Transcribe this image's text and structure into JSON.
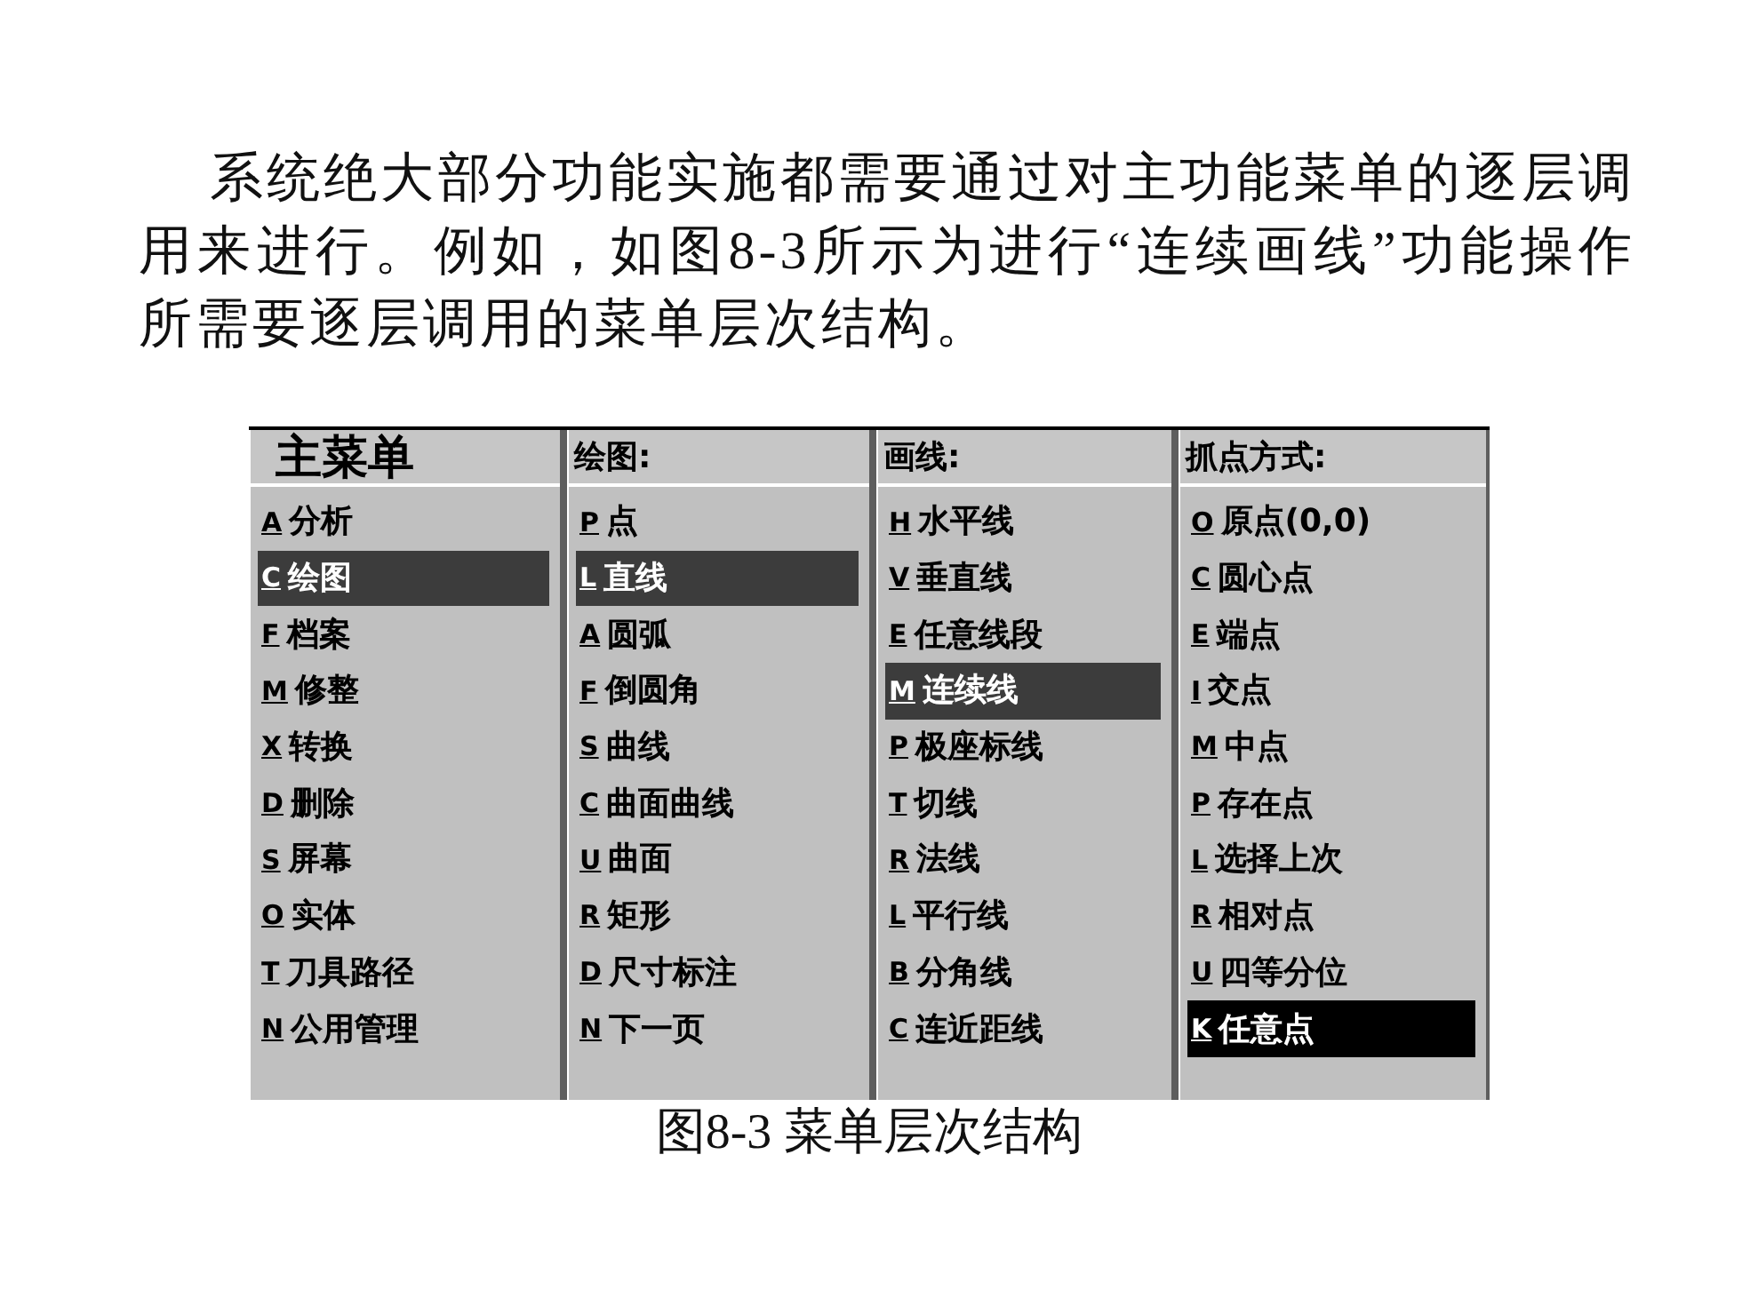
{
  "paragraph": "系统绝大部分功能实施都需要通过对主功能菜单的逐层调用来进行。例如，如图8-3所示为进行“连续画线”功能操作所需要逐层调用的菜单层次结构。",
  "figure": {
    "menus": [
      {
        "kind": "main",
        "title": "主菜单",
        "focused": false,
        "items": [
          {
            "key": "A",
            "label": "分析",
            "selected": false
          },
          {
            "key": "C",
            "label": "绘图",
            "selected": true
          },
          {
            "key": "F",
            "label": "档案",
            "selected": false
          },
          {
            "key": "M",
            "label": "修整",
            "selected": false
          },
          {
            "key": "X",
            "label": "转换",
            "selected": false
          },
          {
            "key": "D",
            "label": "删除",
            "selected": false
          },
          {
            "key": "S",
            "label": "屏幕",
            "selected": false
          },
          {
            "key": "O",
            "label": "实体",
            "selected": false
          },
          {
            "key": "T",
            "label": "刀具路径",
            "selected": false
          },
          {
            "key": "N",
            "label": "公用管理",
            "selected": false
          }
        ]
      },
      {
        "kind": "sub",
        "title": "绘图:",
        "focused": false,
        "items": [
          {
            "key": "P",
            "label": "点",
            "selected": false
          },
          {
            "key": "L",
            "label": "直线",
            "selected": true
          },
          {
            "key": "A",
            "label": "圆弧",
            "selected": false
          },
          {
            "key": "F",
            "label": "倒圆角",
            "selected": false
          },
          {
            "key": "S",
            "label": "曲线",
            "selected": false
          },
          {
            "key": "C",
            "label": "曲面曲线",
            "selected": false
          },
          {
            "key": "U",
            "label": "曲面",
            "selected": false
          },
          {
            "key": "R",
            "label": "矩形",
            "selected": false
          },
          {
            "key": "D",
            "label": "尺寸标注",
            "selected": false
          },
          {
            "key": "N",
            "label": "下一页",
            "selected": false
          }
        ]
      },
      {
        "kind": "sub",
        "title": "画线:",
        "focused": false,
        "items": [
          {
            "key": "H",
            "label": "水平线",
            "selected": false
          },
          {
            "key": "V",
            "label": "垂直线",
            "selected": false
          },
          {
            "key": "E",
            "label": "任意线段",
            "selected": false
          },
          {
            "key": "M",
            "label": "连续线",
            "selected": true
          },
          {
            "key": "P",
            "label": "极座标线",
            "selected": false
          },
          {
            "key": "T",
            "label": "切线",
            "selected": false
          },
          {
            "key": "R",
            "label": "法线",
            "selected": false
          },
          {
            "key": "L",
            "label": "平行线",
            "selected": false
          },
          {
            "key": "B",
            "label": "分角线",
            "selected": false
          },
          {
            "key": "C",
            "label": "连近距线",
            "selected": false
          }
        ]
      },
      {
        "kind": "sub",
        "title": "抓点方式:",
        "focused": true,
        "items": [
          {
            "key": "O",
            "label": "原点(0,0)",
            "selected": false
          },
          {
            "key": "C",
            "label": "圆心点",
            "selected": false
          },
          {
            "key": "E",
            "label": "端点",
            "selected": false
          },
          {
            "key": "I",
            "label": "交点",
            "selected": false
          },
          {
            "key": "M",
            "label": "中点",
            "selected": false
          },
          {
            "key": "P",
            "label": "存在点",
            "selected": false
          },
          {
            "key": "L",
            "label": "选择上次",
            "selected": false
          },
          {
            "key": "R",
            "label": "相对点",
            "selected": false
          },
          {
            "key": "U",
            "label": "四等分位",
            "selected": false
          },
          {
            "key": "K",
            "label": "任意点",
            "selected": true
          }
        ]
      }
    ],
    "caption": "图8-3 菜单层次结构"
  }
}
